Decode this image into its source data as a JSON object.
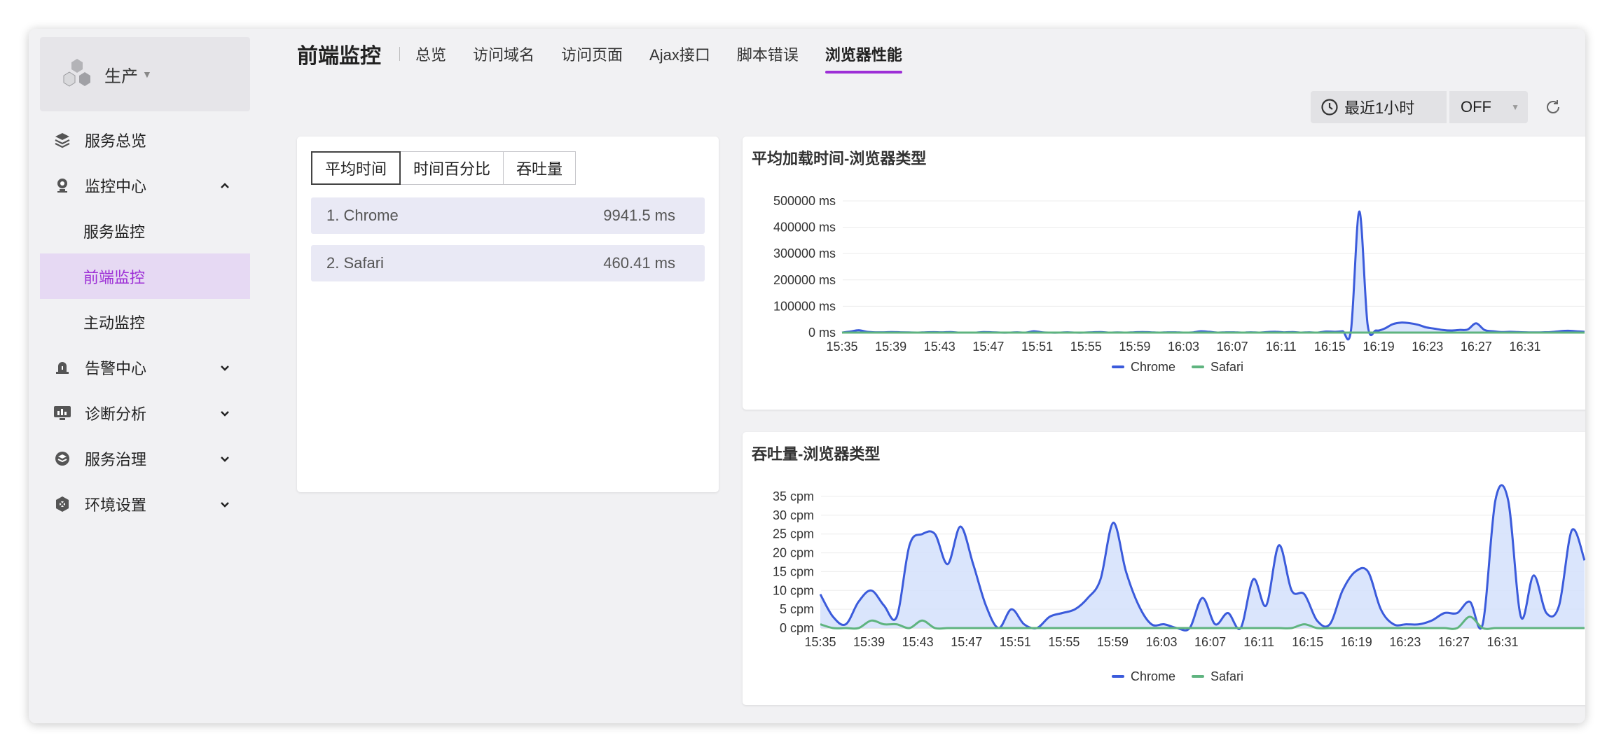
{
  "sidebar": {
    "env_label": "生产",
    "items": [
      {
        "label": "服务总览"
      },
      {
        "label": "监控中心"
      },
      {
        "label": "服务监控"
      },
      {
        "label": "前端监控"
      },
      {
        "label": "主动监控"
      },
      {
        "label": "告警中心"
      },
      {
        "label": "诊断分析"
      },
      {
        "label": "服务治理"
      },
      {
        "label": "环境设置"
      }
    ]
  },
  "header": {
    "brand": "前端监控",
    "tabs": [
      "总览",
      "访问域名",
      "访问页面",
      "Ajax接口",
      "脚本错误",
      "浏览器性能"
    ],
    "active_tab": "浏览器性能"
  },
  "toolbar": {
    "time_range": "最近1小时",
    "refresh_mode": "OFF"
  },
  "left_panel": {
    "tabs": [
      "平均时间",
      "时间百分比",
      "吞吐量"
    ],
    "active_tab": "平均时间",
    "rows": [
      {
        "name": "1. Chrome",
        "value": "9941.5 ms"
      },
      {
        "name": "2. Safari",
        "value": "460.41 ms"
      }
    ]
  },
  "colors": {
    "accent": "#9d2fd6",
    "chrome": "#3b5bdb",
    "chrome_fill": "#d3e1fb",
    "safari": "#5fb47f"
  },
  "chart_data": [
    {
      "type": "area",
      "title": "平均加载时间-浏览器类型",
      "unit": "ms",
      "ylim": [
        0,
        500000
      ],
      "y_ticks": [
        "0 ms",
        "100000 ms",
        "200000 ms",
        "300000 ms",
        "400000 ms",
        "500000 ms"
      ],
      "x_ticks": [
        "15:35",
        "15:39",
        "15:43",
        "15:47",
        "15:51",
        "15:55",
        "15:59",
        "16:03",
        "16:07",
        "16:11",
        "16:15",
        "16:19",
        "16:23",
        "16:27",
        "16:31"
      ],
      "legend": [
        "Chrome",
        "Safari"
      ],
      "legend_position": "bottom",
      "series": [
        {
          "name": "Chrome",
          "values": [
            0,
            4000,
            9000,
            3000,
            1000,
            1000,
            2000,
            1000,
            500,
            0,
            1000,
            1500,
            1000,
            2000,
            0,
            0,
            0,
            2000,
            1000,
            0,
            0,
            1000,
            0,
            5000,
            1000,
            0,
            0,
            1000,
            0,
            0,
            1000,
            2000,
            0,
            500,
            0,
            1000,
            2000,
            1000,
            0,
            1000,
            1000,
            0,
            500,
            5000,
            3000,
            0,
            1000,
            1000,
            0,
            1000,
            0,
            2000,
            3000,
            1000,
            2000,
            0,
            1000,
            0,
            4000,
            3000,
            5000,
            8000,
            460000,
            30000,
            8000,
            15000,
            32000,
            38000,
            36000,
            30000,
            20000,
            15000,
            10000,
            8000,
            10000,
            12000,
            35000,
            10000,
            5000,
            2000,
            3000,
            2000,
            1000,
            500,
            1000,
            2000,
            5000,
            7000,
            5000,
            3000
          ]
        },
        {
          "name": "Safari",
          "values": [
            0,
            0,
            0,
            0,
            0,
            0,
            0,
            0,
            0,
            0,
            0,
            0,
            0,
            0,
            0,
            0,
            0,
            0,
            0,
            0,
            0,
            0,
            0,
            0,
            0,
            0,
            0,
            0,
            0,
            0,
            0,
            0,
            0,
            0,
            0,
            0,
            0,
            0,
            0,
            0,
            0,
            0,
            0,
            0,
            0,
            0,
            0,
            0,
            0,
            0,
            0,
            0,
            0,
            0,
            0,
            0,
            0,
            0,
            0,
            0,
            0,
            0,
            0,
            0,
            0,
            0,
            0,
            0,
            0,
            0,
            0,
            0,
            0,
            0,
            0,
            0,
            0,
            0,
            0,
            0,
            0,
            0,
            0,
            0,
            0,
            0,
            0,
            0,
            0,
            0
          ]
        }
      ]
    },
    {
      "type": "area",
      "title": "吞吐量-浏览器类型",
      "unit": "cpm",
      "ylim": [
        0,
        35
      ],
      "y_ticks": [
        "0 cpm",
        "5 cpm",
        "10 cpm",
        "15 cpm",
        "20 cpm",
        "25 cpm",
        "30 cpm",
        "35 cpm"
      ],
      "x_ticks": [
        "15:35",
        "15:39",
        "15:43",
        "15:47",
        "15:51",
        "15:55",
        "15:59",
        "16:03",
        "16:07",
        "16:11",
        "16:15",
        "16:19",
        "16:23",
        "16:27",
        "16:31"
      ],
      "legend": [
        "Chrome",
        "Safari"
      ],
      "legend_position": "bottom",
      "series": [
        {
          "name": "Chrome",
          "values": [
            9,
            3,
            1,
            7,
            10,
            6,
            3,
            22,
            25,
            25,
            17,
            27,
            17,
            6,
            0,
            5,
            1,
            0,
            3,
            4,
            5,
            8,
            13,
            28,
            15,
            6,
            1,
            1,
            0,
            0,
            8,
            1,
            4,
            0,
            13,
            6,
            22,
            10,
            9,
            2,
            1,
            10,
            15,
            15,
            5,
            1,
            1,
            1,
            2,
            4,
            4,
            7,
            1,
            34,
            34,
            3,
            14,
            4,
            6,
            26,
            18
          ]
        },
        {
          "name": "Safari",
          "values": [
            1,
            0,
            0,
            0,
            2,
            1,
            1,
            0,
            2,
            0,
            0,
            0,
            0,
            0,
            0,
            0,
            0,
            0,
            0,
            0,
            0,
            0,
            0,
            0,
            0,
            0,
            0,
            0,
            0,
            0,
            0,
            0,
            0,
            0,
            0,
            0,
            0,
            0,
            1,
            0,
            0,
            0,
            0,
            0,
            0,
            0,
            0,
            0,
            0,
            0,
            0,
            3,
            0,
            0,
            0,
            0,
            0,
            0,
            0,
            0,
            0
          ]
        }
      ]
    }
  ]
}
